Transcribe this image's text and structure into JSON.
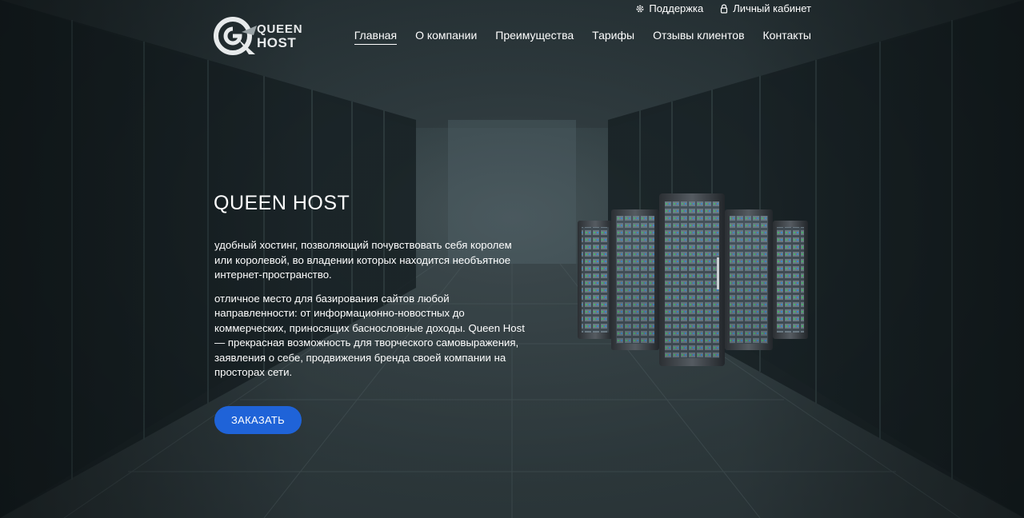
{
  "header": {
    "logo": {
      "line1": "QUEEN",
      "line2": "HOST"
    },
    "top_links": [
      {
        "label": "Поддержка",
        "icon": "gear-icon"
      },
      {
        "label": "Личный кабинет",
        "icon": "lock-icon"
      }
    ],
    "nav": [
      {
        "label": "Главная",
        "active": true
      },
      {
        "label": "О компании"
      },
      {
        "label": "Преимущества"
      },
      {
        "label": "Тарифы"
      },
      {
        "label": "Отзывы клиентов"
      },
      {
        "label": "Контакты"
      }
    ]
  },
  "hero": {
    "title": "QUEEN HOST",
    "paragraphs": [
      "удобный хостинг, позволяющий почувствовать себя королем или королевой, во владении которых находится необъятное интернет-пространство.",
      "отличное место для базирования сайтов любой направленности: от информационно-новостных до коммерческих, приносящих баснословные доходы. Queen Host — прекрасная возможность для творческого самовыражения, заявления о себе, продвижения бренда своей компании на просторах сети."
    ],
    "button": "ЗАКАЗАТЬ",
    "image": "server-racks-illustration"
  },
  "colors": {
    "accent": "#1f63d8",
    "background": "#1c2629",
    "text": "#ffffff"
  }
}
